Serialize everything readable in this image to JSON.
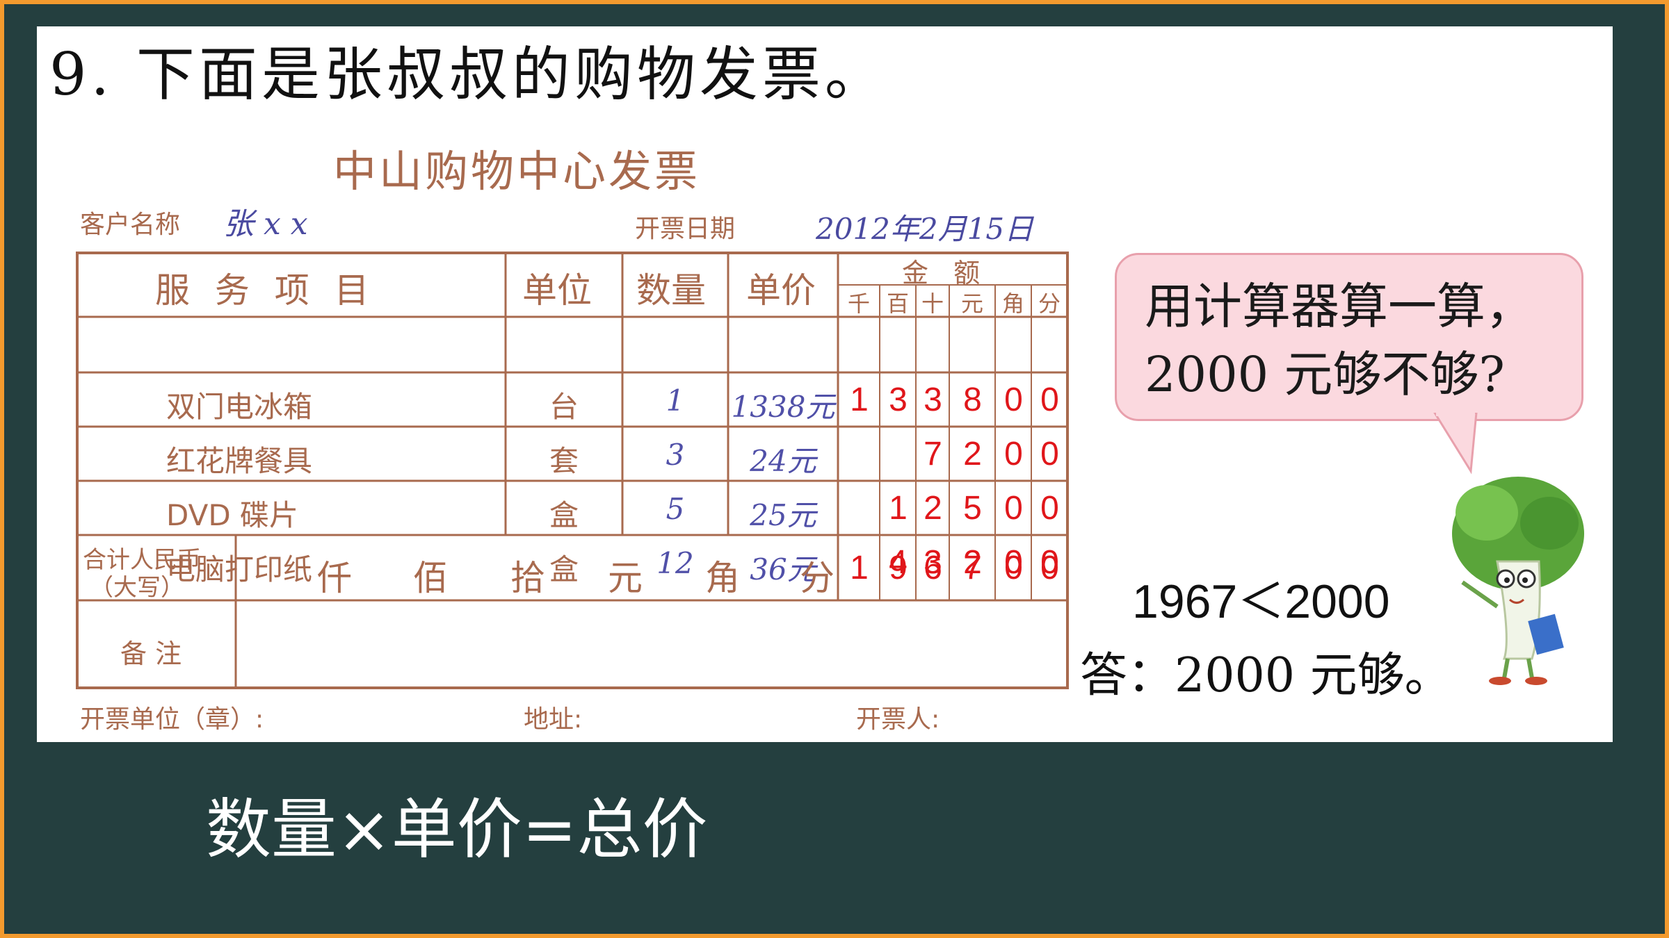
{
  "question_title": "9. 下面是张叔叔的购物发票。",
  "invoice": {
    "title": "中山购物中心发票",
    "customer_label": "客户名称",
    "customer_name": "张 x x",
    "date_label": "开票日期",
    "date_value": "2012年2月15日",
    "headers": {
      "item": "服 务 项 目",
      "unit": "单位",
      "qty": "数量",
      "price": "单价",
      "amount": "金 额",
      "amount_cols": [
        "千",
        "百",
        "十",
        "元",
        "角",
        "分"
      ]
    },
    "rows": [
      {
        "item": "双门电冰箱",
        "unit": "台",
        "qty": "1",
        "price": "1338元",
        "digits": [
          "1",
          "3",
          "3",
          "8",
          "0",
          "0"
        ]
      },
      {
        "item": "红花牌餐具",
        "unit": "套",
        "qty": "3",
        "price": "24元",
        "digits": [
          "",
          "",
          "7",
          "2",
          "0",
          "0"
        ]
      },
      {
        "item": "DVD 碟片",
        "unit": "盒",
        "qty": "5",
        "price": "25元",
        "digits": [
          "",
          "1",
          "2",
          "5",
          "0",
          "0"
        ]
      },
      {
        "item": "电脑打印纸",
        "unit": "盒",
        "qty": "12",
        "price": "36元",
        "digits": [
          "",
          "4",
          "3",
          "2",
          "0",
          "0"
        ]
      }
    ],
    "total_label_1": "合计人民币",
    "total_label_2": "（大写）",
    "total_units": [
      "仟",
      "佰",
      "拾",
      "元",
      "角",
      "分"
    ],
    "total_digits": [
      "1",
      "9",
      "6",
      "7",
      "0",
      "0"
    ],
    "remarks_label": "备 注",
    "footer": {
      "issuer": "开票单位（章）:",
      "address": "地址:",
      "issued_by": "开票人:"
    }
  },
  "bubble": {
    "line1": "用计算器算一算，",
    "line2": "2000 元够不够?"
  },
  "comparison": "1967＜2000",
  "answer": "答：2000 元够。",
  "formula": "数量×单价=总价",
  "colors": {
    "board": "#243f3f",
    "frame": "#f39a2e",
    "invoice_ink": "#a86a4e",
    "handwriting": "#4a4aa0",
    "digits": "#e0161a",
    "bubble_fill": "#fbd9df"
  }
}
